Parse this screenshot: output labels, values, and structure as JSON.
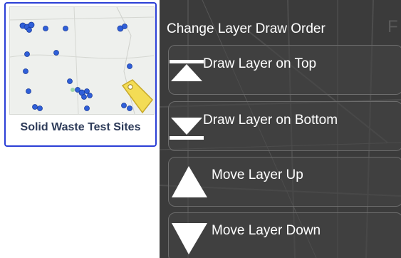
{
  "layer": {
    "title": "Solid Waste Test Sites"
  },
  "menu": {
    "title": "Change Layer Draw Order",
    "items": [
      {
        "label": "Draw Layer on Top",
        "icon": "bring-to-top-icon"
      },
      {
        "label": "Draw Layer on Bottom",
        "icon": "send-to-bottom-icon"
      },
      {
        "label": "Move Layer Up",
        "icon": "arrow-up-icon"
      },
      {
        "label": "Move Layer Down",
        "icon": "arrow-down-icon"
      }
    ]
  },
  "colors": {
    "accent_border": "#2b3fd6",
    "panel_bg": "#3a3a3a",
    "marker_blue": "#2f5fd9",
    "tag_yellow": "#f3dc55"
  }
}
